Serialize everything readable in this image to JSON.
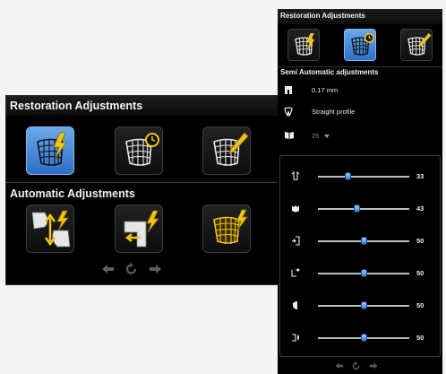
{
  "left_panel": {
    "title": "Restoration Adjustments",
    "subtitle": "Automatic Adjustments",
    "restoration_buttons": [
      {
        "icon": "mesh-lightning-icon",
        "selected": true
      },
      {
        "icon": "mesh-clock-icon",
        "selected": false
      },
      {
        "icon": "mesh-pencil-icon",
        "selected": false
      }
    ],
    "automatic_buttons": [
      {
        "icon": "contact-adjust-icon"
      },
      {
        "icon": "margin-adjust-icon"
      },
      {
        "icon": "mesh-grid-gold-icon"
      }
    ],
    "nav": [
      "undo-arrow-icon",
      "reset-icon",
      "redo-arrow-icon"
    ]
  },
  "right_panel": {
    "title": "Restoration Adjustments",
    "subtitle": "Semi Automatic adjustments",
    "thickness": "0.17 mm",
    "profile": "Straight profile",
    "library_value": "25",
    "sliders": [
      {
        "icon": "occlusal-icon",
        "value": 33
      },
      {
        "icon": "tooth-icon",
        "value": 43
      },
      {
        "icon": "mesial-icon",
        "value": 50
      },
      {
        "icon": "distal-icon",
        "value": 50
      },
      {
        "icon": "buccal-icon",
        "value": 50
      },
      {
        "icon": "lingual-icon",
        "value": 50
      }
    ]
  },
  "colors": {
    "accent": "#3f82d8",
    "lightning": "#f2c417",
    "panel": "#000000"
  }
}
